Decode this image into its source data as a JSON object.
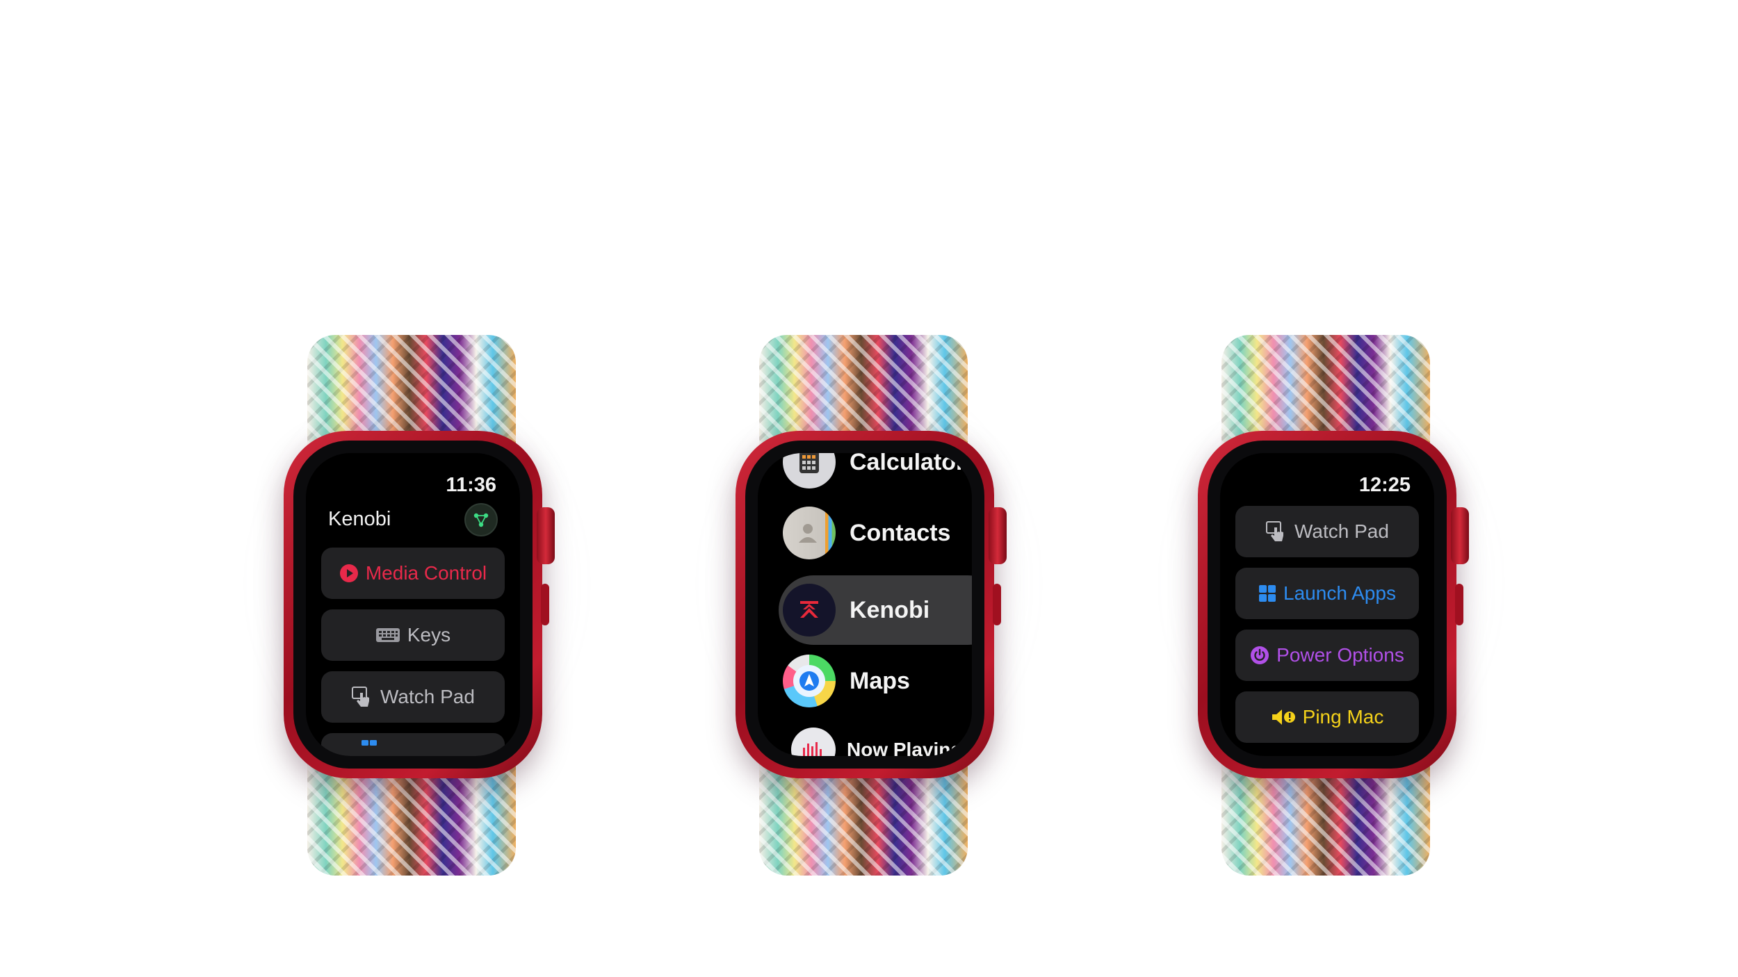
{
  "watch1": {
    "time": "11:36",
    "app_title": "Kenobi",
    "buttons": [
      {
        "label": "Media Control",
        "icon": "play-circle-icon",
        "color": "#e8294a"
      },
      {
        "label": "Keys",
        "icon": "keyboard-icon",
        "color": "#bdbdc2"
      },
      {
        "label": "Watch Pad",
        "icon": "hand-pointer-icon",
        "color": "#bdbdc2"
      }
    ]
  },
  "watch2": {
    "apps": [
      {
        "label": "Calculator",
        "icon": "calculator-icon"
      },
      {
        "label": "Contacts",
        "icon": "contacts-icon"
      },
      {
        "label": "Kenobi",
        "icon": "kenobi-icon"
      },
      {
        "label": "Maps",
        "icon": "maps-icon"
      },
      {
        "label": "Now Playing",
        "icon": "now-playing-icon"
      }
    ],
    "selected": "Kenobi"
  },
  "watch3": {
    "time": "12:25",
    "buttons": [
      {
        "label": "Watch Pad",
        "icon": "hand-pointer-icon",
        "color": "#bdbdc2"
      },
      {
        "label": "Launch Apps",
        "icon": "grid-icon",
        "color": "#2d8cf0"
      },
      {
        "label": "Power Options",
        "icon": "power-icon",
        "color": "#b150e8"
      },
      {
        "label": "Ping Mac",
        "icon": "speaker-icon",
        "color": "#f5d21a"
      }
    ]
  },
  "colors": {
    "case_red": "#b5162a",
    "screen_bg": "#000000",
    "button_bg": "#222224"
  }
}
